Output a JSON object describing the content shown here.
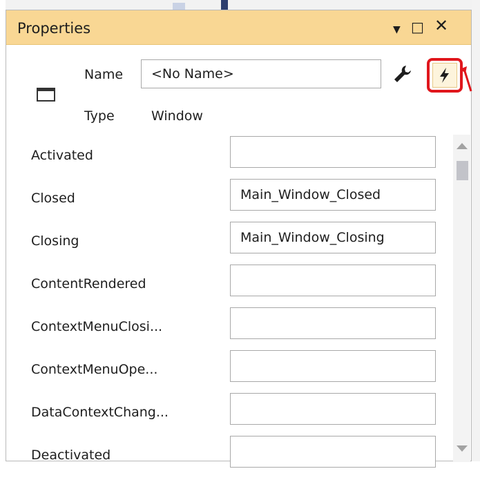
{
  "panel": {
    "title": "Properties",
    "controls": {
      "dropdown": "▼",
      "maximize": "□",
      "close": "✕"
    }
  },
  "header": {
    "name_label": "Name",
    "name_value": "<No Name>",
    "type_label": "Type",
    "type_value": "Window",
    "icons": {
      "window": "window-icon",
      "properties": "wrench-icon",
      "events": "lightning-bolt-icon"
    }
  },
  "events": [
    {
      "name": "Activated",
      "handler": ""
    },
    {
      "name": "Closed",
      "handler": "Main_Window_Closed"
    },
    {
      "name": "Closing",
      "handler": "Main_Window_Closing"
    },
    {
      "name": "ContentRendered",
      "handler": ""
    },
    {
      "name": "ContextMenuClosi...",
      "handler": ""
    },
    {
      "name": "ContextMenuOpe...",
      "handler": ""
    },
    {
      "name": "DataContextChang...",
      "handler": ""
    },
    {
      "name": "Deactivated",
      "handler": ""
    }
  ],
  "colors": {
    "titlebar": "#f9d794",
    "highlight": "#e0161c",
    "active_button": "#fdf4dc"
  }
}
